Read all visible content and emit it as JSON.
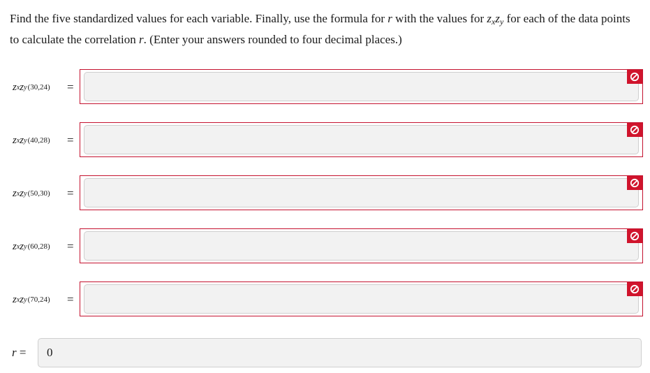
{
  "instructions": {
    "part1": "Find the five standardized values for each variable. Finally, use the formula for ",
    "r_symbol": "r",
    "part2": " with the values for ",
    "z_symbol": "z",
    "x_sub": "x",
    "y_sub": "y",
    "part3": " for each of the data points to calculate the correlation ",
    "part4": ". (Enter your answers rounded to four decimal places.)"
  },
  "rows": [
    {
      "coord": "(30,24)",
      "value": ""
    },
    {
      "coord": "(40,28)",
      "value": ""
    },
    {
      "coord": "(50,30)",
      "value": ""
    },
    {
      "coord": "(60,28)",
      "value": ""
    },
    {
      "coord": "(70,24)",
      "value": ""
    }
  ],
  "row_label": {
    "z": "z",
    "x": "x",
    "y": "y"
  },
  "equals": "=",
  "r_answer": {
    "label": "r",
    "equals": "=",
    "value": "0"
  },
  "colors": {
    "error_red": "#d0142c",
    "input_bg": "#f2f2f2",
    "input_border": "#cfcfcf"
  },
  "icons": {
    "error": "no-entry-icon"
  }
}
